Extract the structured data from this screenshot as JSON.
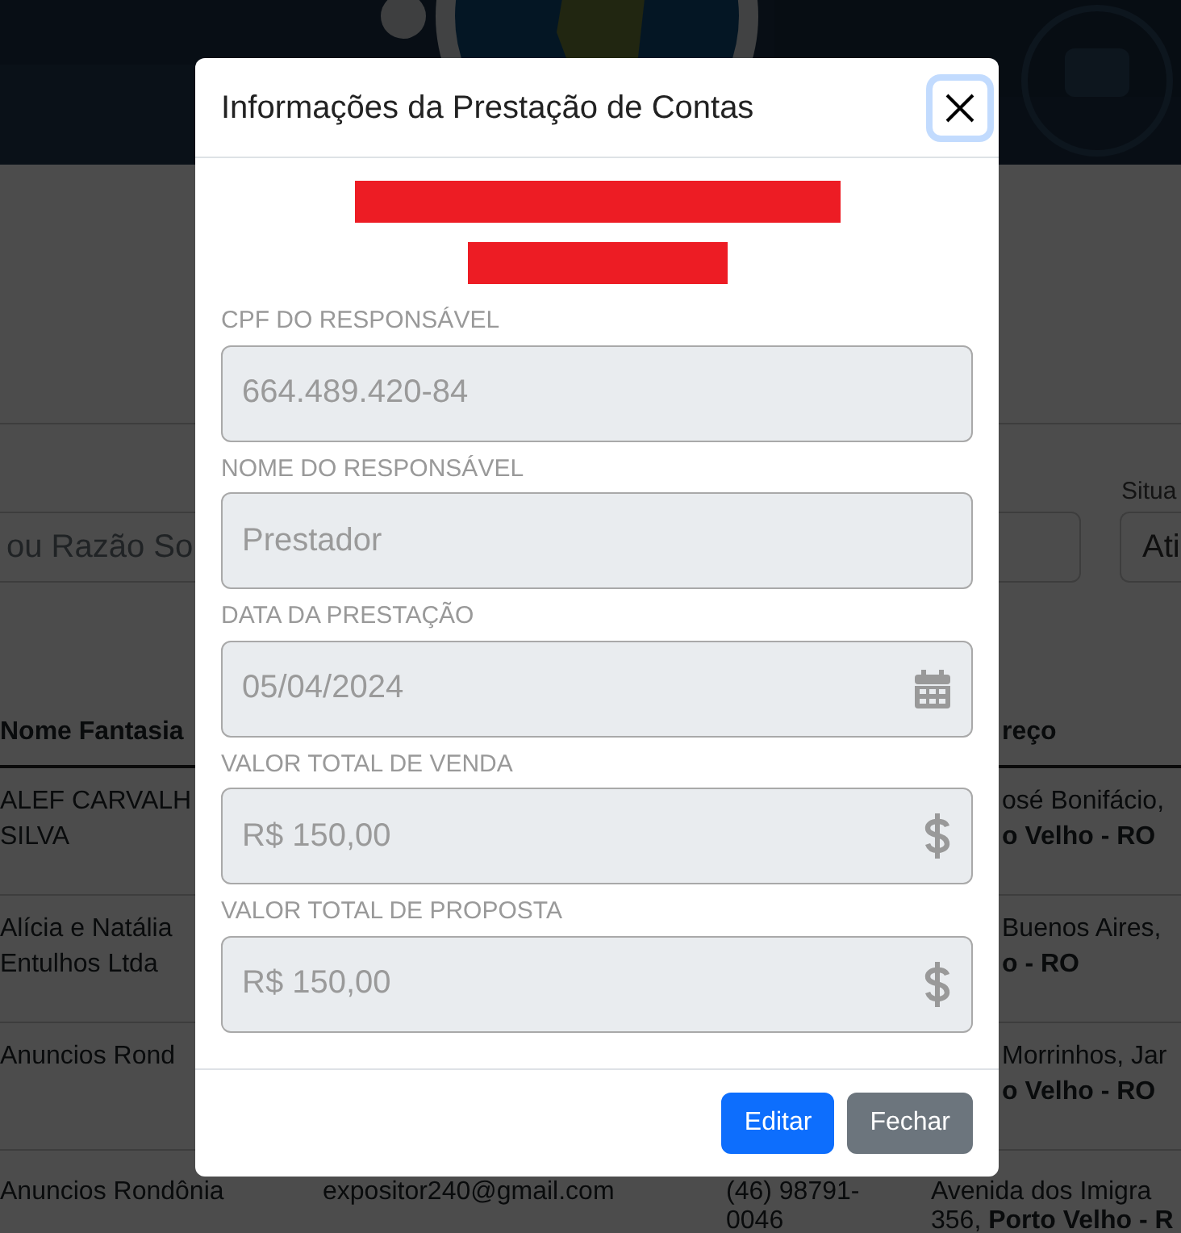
{
  "background": {
    "filters": {
      "search": {
        "placeholder": "ou Razão So"
      },
      "status": {
        "label": "Situa",
        "value": "Ati"
      }
    },
    "table": {
      "columns": [
        "Nome Fantasia",
        "reço"
      ],
      "rows": [
        {
          "name": [
            "ALEF CARVALH",
            "SILVA"
          ],
          "email": [],
          "phone": [],
          "address": [
            {
              "text": "osé Bonifácio,",
              "bold": false
            },
            {
              "text": "o Velho - RO",
              "bold": true
            }
          ]
        },
        {
          "name": [
            "Alícia e Natália",
            "Entulhos Ltda"
          ],
          "email": [],
          "phone": [],
          "address": [
            {
              "text": "Buenos Aires,",
              "bold": false
            },
            {
              "text": "o - RO",
              "bold": true
            }
          ]
        },
        {
          "name": [
            "Anuncios Rond"
          ],
          "email": [],
          "phone": [],
          "address": [
            {
              "text": "Morrinhos, Jar",
              "bold": false
            },
            {
              "text": "o Velho - RO",
              "bold": true
            }
          ]
        },
        {
          "name": [
            "Anuncios Rondônia"
          ],
          "email": [
            "expositor240@gmail.com"
          ],
          "phone": [
            "(46) 98791-",
            "0046"
          ],
          "address": [
            {
              "text": "Avenida dos Imigra",
              "bold": false
            },
            {
              "text": "356, **Porto Velho - R**",
              "bold": false
            }
          ]
        }
      ]
    }
  },
  "modal": {
    "title": "Informações da Prestação de Contas",
    "close_focused": true,
    "redactions": [
      {
        "kind": "long"
      },
      {
        "kind": "short"
      }
    ],
    "fields": [
      {
        "label": "CPF DO RESPONSÁVEL",
        "value": "664.489.420-84",
        "kind": "text"
      },
      {
        "label": "NOME DO RESPONSÁVEL",
        "value": "Prestador",
        "kind": "text"
      },
      {
        "label": "DATA DA PRESTAÇÃO",
        "value": "05/04/2024",
        "kind": "date"
      },
      {
        "label": "VALOR TOTAL DE VENDA",
        "value": "R$ 150,00",
        "kind": "currency"
      },
      {
        "label": "VALOR TOTAL DE PROPOSTA",
        "value": "R$ 150,00",
        "kind": "currency"
      }
    ],
    "buttons": [
      {
        "label": "Editar",
        "kind": "primary"
      },
      {
        "label": "Fechar",
        "kind": "secondary"
      }
    ]
  }
}
